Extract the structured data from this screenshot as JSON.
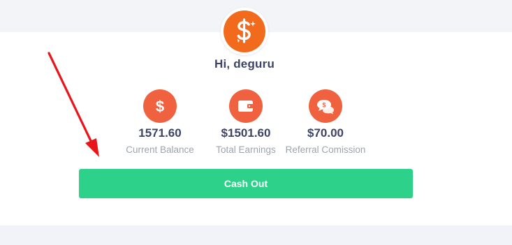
{
  "greeting": "Hi, deguru",
  "stats": [
    {
      "value": "1571.60",
      "label": "Current Balance",
      "icon": "dollar-icon"
    },
    {
      "value": "$1501.60",
      "label": "Total Earnings",
      "icon": "wallet-icon"
    },
    {
      "value": "$70.00",
      "label": "Referral Comission",
      "icon": "chat-dollar-icon"
    }
  ],
  "cash_out_label": "Cash Out",
  "colors": {
    "avatar": "#f26b1d",
    "stat_circle": "#f0623f",
    "button": "#2ed189",
    "annotation_arrow": "#e8161a"
  }
}
